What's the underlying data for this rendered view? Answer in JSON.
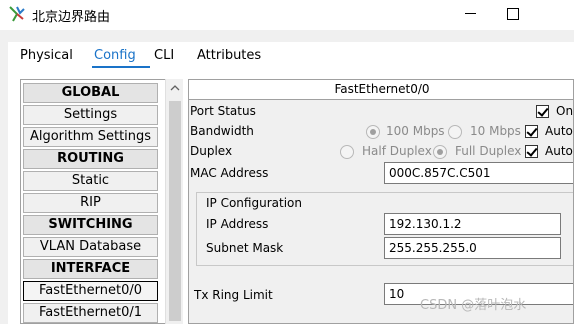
{
  "window": {
    "title": "北京边界路由"
  },
  "tabs": [
    {
      "label": "Physical"
    },
    {
      "label": "Config",
      "active": true
    },
    {
      "label": "CLI"
    },
    {
      "label": "Attributes"
    }
  ],
  "sidebar": {
    "items": [
      {
        "label": "GLOBAL",
        "type": "header"
      },
      {
        "label": "Settings",
        "type": "item"
      },
      {
        "label": "Algorithm Settings",
        "type": "item"
      },
      {
        "label": "ROUTING",
        "type": "header"
      },
      {
        "label": "Static",
        "type": "item"
      },
      {
        "label": "RIP",
        "type": "item"
      },
      {
        "label": "SWITCHING",
        "type": "header"
      },
      {
        "label": "VLAN Database",
        "type": "item"
      },
      {
        "label": "INTERFACE",
        "type": "header"
      },
      {
        "label": "FastEthernet0/0",
        "type": "item",
        "selected": true
      },
      {
        "label": "FastEthernet0/1",
        "type": "item"
      }
    ]
  },
  "panel": {
    "title": "FastEthernet0/0",
    "port_status": {
      "label": "Port Status",
      "option_label": "On",
      "checked": true
    },
    "bandwidth": {
      "label": "Bandwidth",
      "option1": "100 Mbps",
      "option2": "10 Mbps",
      "auto_label": "Auto",
      "auto_checked": true,
      "selected": "100 Mbps"
    },
    "duplex": {
      "label": "Duplex",
      "option1": "Half Duplex",
      "option2": "Full Duplex",
      "auto_label": "Auto",
      "auto_checked": true,
      "selected": "Full Duplex"
    },
    "mac": {
      "label": "MAC Address",
      "value": "000C.857C.C501"
    },
    "ip_config": {
      "title": "IP Configuration",
      "ip_label": "IP Address",
      "ip_value": "192.130.1.2",
      "mask_label": "Subnet Mask",
      "mask_value": "255.255.255.0"
    },
    "tx_ring": {
      "label": "Tx Ring Limit",
      "value": "10"
    }
  },
  "watermark": "CSDN @落叶泡水",
  "colors": {
    "accent": "#1a73c8"
  }
}
